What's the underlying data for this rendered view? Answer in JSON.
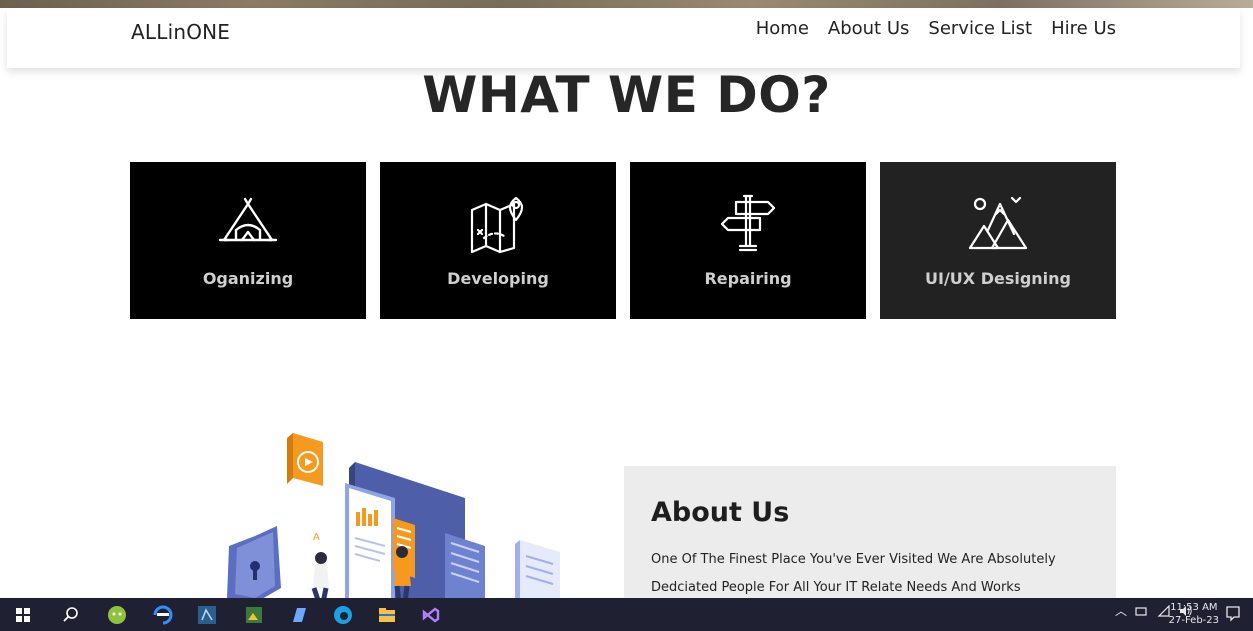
{
  "nav": {
    "brand": "ALLinONE",
    "links": [
      "Home",
      "About Us",
      "Service List",
      "Hire Us"
    ]
  },
  "section": {
    "title": "WHAT WE DO?"
  },
  "services": [
    {
      "label": "Oganizing",
      "icon": "tent-icon"
    },
    {
      "label": "Developing",
      "icon": "map-pin-icon"
    },
    {
      "label": "Repairing",
      "icon": "signpost-icon"
    },
    {
      "label": "UI/UX Designing",
      "icon": "mountains-icon"
    }
  ],
  "about": {
    "heading": "About Us",
    "text": "One Of The Finest Place You've Ever Visited We Are Absolutely Dedciated People For All Your IT Relate Needs And Works"
  },
  "taskbar": {
    "time": "11:53 AM",
    "date": "27-Feb-23"
  },
  "colors": {
    "card_bg": "#000000",
    "card_bg_alt": "#222222",
    "about_bg": "#ececec",
    "taskbar_bg": "#1f2133",
    "accent_orange": "#f59a1e"
  }
}
